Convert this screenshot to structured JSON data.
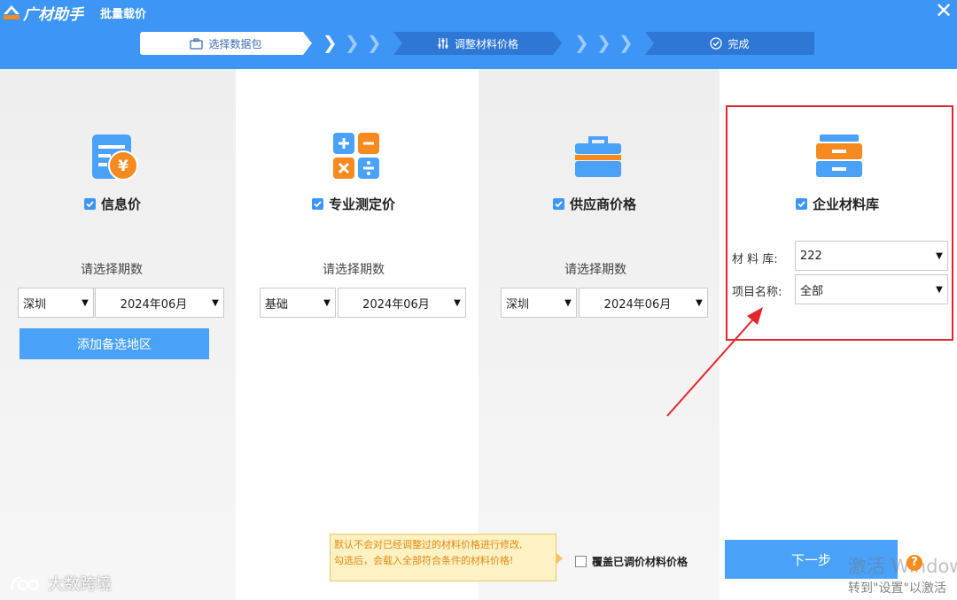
{
  "header": {
    "logo_text": "广材助手",
    "window_title": "批量载价",
    "close_symbol": "✕"
  },
  "steps": [
    {
      "label": "选择数据包",
      "icon": "briefcase-icon",
      "state": "active"
    },
    {
      "label": "调整材料价格",
      "icon": "sliders-icon",
      "state": "inactive"
    },
    {
      "label": "完成",
      "icon": "check-circle-icon",
      "state": "inactive"
    }
  ],
  "step_chevron": "❯",
  "columns": {
    "info_price": {
      "icon": "price-doc-icon",
      "checked": true,
      "label": "信息价",
      "period_label": "请选择期数",
      "region": "深圳",
      "period": "2024年06月",
      "add_region_button": "添加备选地区"
    },
    "measured_price": {
      "icon": "calculator-icon",
      "checked": true,
      "label": "专业测定价",
      "period_label": "请选择期数",
      "region": "基础",
      "period": "2024年06月"
    },
    "supplier_price": {
      "icon": "toolbox-icon",
      "checked": true,
      "label": "供应商价格",
      "period_label": "请选择期数",
      "region": "深圳",
      "period": "2024年06月"
    },
    "enterprise_lib": {
      "icon": "cabinet-icon",
      "checked": true,
      "label": "企业材料库",
      "library_label": "材 料 库:",
      "library_value": "222",
      "project_label": "项目名称:",
      "project_value": "全部"
    }
  },
  "footer": {
    "tip_line1": "默认不会对已经调整过的材料价格进行修改,",
    "tip_line2": "勾选后，会载入全部符合条件的材料价格!",
    "cover_checkbox_label": "覆盖已调价材料价格",
    "cover_checked": false,
    "next_button": "下一步",
    "help_symbol": "?"
  },
  "os_overlay": {
    "activate_line1": "激活 Windows",
    "activate_line2": "转到\"设置\"以激活"
  },
  "watermark": {
    "text": "大数跨境"
  },
  "colors": {
    "header_blue": "#3d95f5",
    "button_blue": "#4aa1f8",
    "highlight_red": "#e3262b",
    "tip_bg": "#fef1c3",
    "icon_orange": "#f58a1f"
  }
}
